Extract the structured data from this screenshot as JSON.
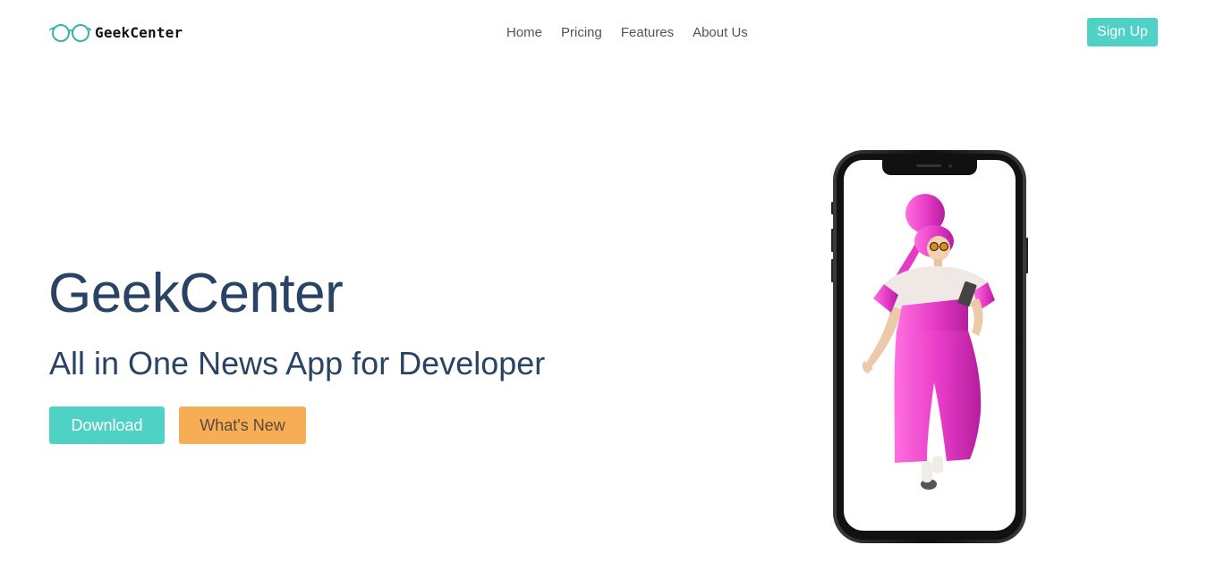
{
  "brand": {
    "name": "GeekCenter",
    "logo_icon": "glasses-icon",
    "accent": "#38b2ac"
  },
  "nav": {
    "links": [
      {
        "label": "Home"
      },
      {
        "label": "Pricing"
      },
      {
        "label": "Features"
      },
      {
        "label": "About Us"
      }
    ],
    "signup_label": "Sign Up"
  },
  "hero": {
    "title": "GeekCenter",
    "subtitle": "All in One News App for Developer",
    "download_label": "Download",
    "whats_new_label": "What's New",
    "illustration": "phone-with-character-illustration"
  },
  "colors": {
    "primary": "#4fd1c5",
    "secondary": "#f6ad55",
    "heading": "#2a4365",
    "nav_text": "#4a5563",
    "figure_pink": "#e83fc7"
  }
}
